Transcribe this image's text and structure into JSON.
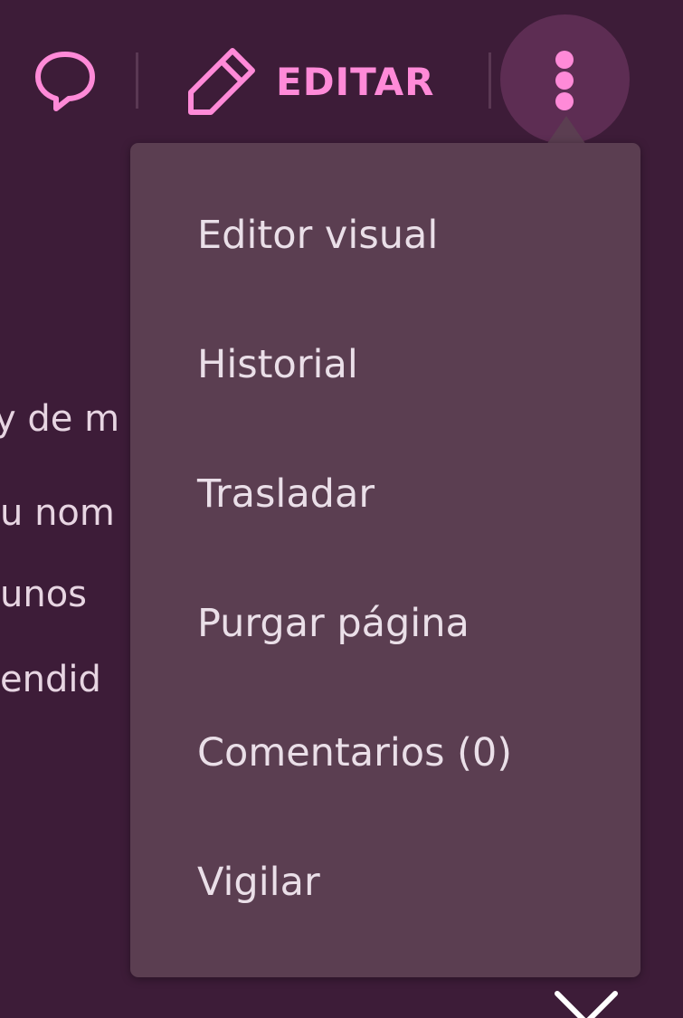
{
  "toolbar": {
    "comment_icon": "speech-bubble-icon",
    "edit_icon": "pencil-icon",
    "edit_label": "EDITAR",
    "more_icon": "vertical-ellipsis-icon",
    "accent_color": "#ff8ad8"
  },
  "article_fragments": [
    "y de m",
    "u nom",
    " unos",
    "endid"
  ],
  "menu": {
    "items": [
      {
        "label": "Editor visual"
      },
      {
        "label": "Historial"
      },
      {
        "label": "Trasladar"
      },
      {
        "label": "Purgar página"
      },
      {
        "label": "Comentarios (0)"
      },
      {
        "label": "Vigilar"
      }
    ]
  },
  "close_icon": "close-icon",
  "colors": {
    "background": "#3d1c38",
    "menu_background": "#5b3e51",
    "menu_text": "#eadfe8",
    "more_button_background": "#5d2d53"
  }
}
